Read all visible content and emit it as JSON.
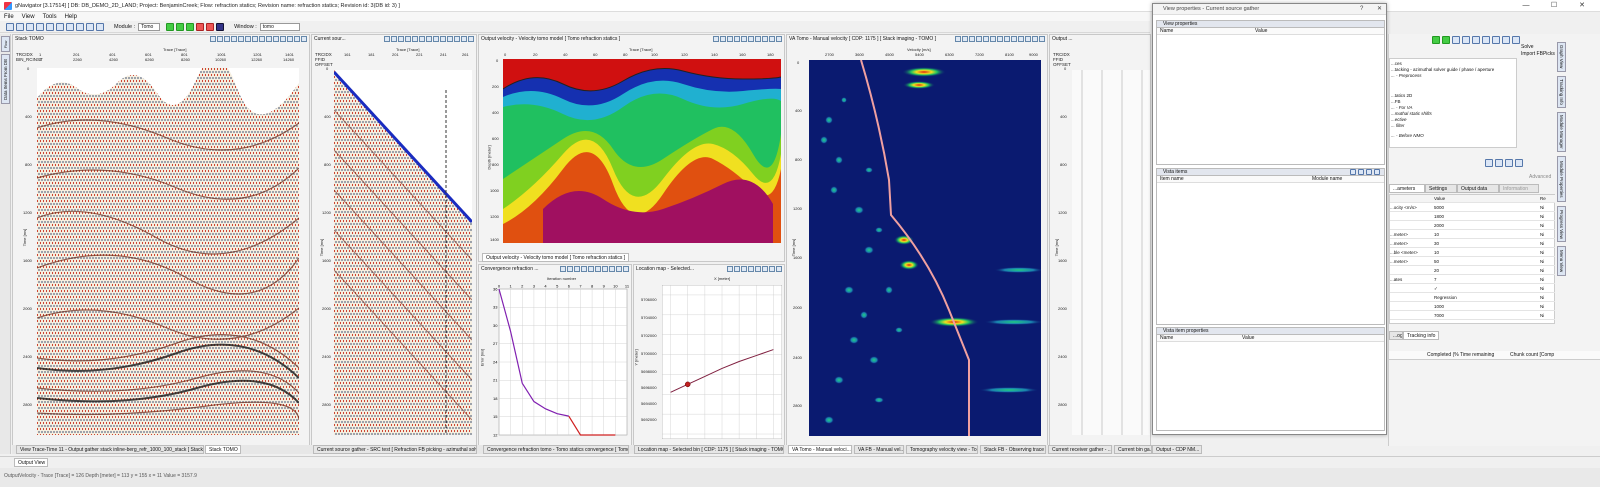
{
  "window": {
    "title": "gNavigator [3.17514] [ DB: DB_DEMO_2D_LAND; Project: BenjaminCreek; Flow: refraction statics; Revision name: refraction statics; Revision id: 3(DB id: 3) ]",
    "controls": [
      "—",
      "☐",
      "✕"
    ]
  },
  "menu": [
    "File",
    "View",
    "Tools",
    "Help"
  ],
  "toolbar": {
    "module_label": "Module :",
    "module_value": "Tomo",
    "window_label": "Window :",
    "window_value": "tomo"
  },
  "left_tabs": [
    "Data Items From DB",
    "Flow Manager"
  ],
  "panels": {
    "stack": {
      "title": "Stack TOMO",
      "headers": [
        "TRCIDX",
        "BIN_RCINST"
      ],
      "x_label": "Trace [Trace]",
      "x_ticks": [
        "1",
        "201",
        "401",
        "601",
        "801",
        "1001",
        "1201",
        "1401"
      ],
      "x_ticks2": [
        "1",
        "2260",
        "4260",
        "6260",
        "8260",
        "10260",
        "12260",
        "14260"
      ],
      "y_label": "Time [ms]",
      "y_ticks": [
        "0",
        "400",
        "800",
        "1200",
        "1600",
        "2000",
        "2400",
        "2800"
      ]
    },
    "source": {
      "title": "Current sour...",
      "headers": [
        "TRCIDX",
        "FFID",
        "OFFSET"
      ],
      "x_label": "Trace [Trace]",
      "x_ticks": [
        "161",
        "181",
        "201",
        "221",
        "241",
        "261"
      ],
      "y_label": "Time [ms]",
      "y_ticks": [
        "0",
        "400",
        "800",
        "1200",
        "1600",
        "2000",
        "2400",
        "2800"
      ]
    },
    "velocity": {
      "title": "Output velocity - Velocity tomo model [ Tomo refraction statics ]",
      "x_label": "Trace [Trace]",
      "x_ticks": [
        "0",
        "20",
        "40",
        "60",
        "80",
        "100",
        "120",
        "140",
        "160",
        "180"
      ],
      "y_label": "Depth [meter]",
      "y_ticks": [
        "0",
        "200",
        "400",
        "600",
        "800",
        "1000",
        "1200",
        "1400"
      ],
      "tab": "Output velocity - Velocity tomo model [ Tomo refraction statics ]"
    },
    "convergence": {
      "title": "Convergence refraction ...",
      "x_label": "Iteration number",
      "x_ticks": [
        "0",
        "1",
        "2",
        "3",
        "4",
        "5",
        "6",
        "7",
        "8",
        "9",
        "10",
        "11"
      ],
      "y_label": "Error [ms]",
      "y_ticks": [
        "36",
        "33",
        "30",
        "27",
        "24",
        "21",
        "18",
        "15",
        "12"
      ]
    },
    "location": {
      "title": "Location map - Selected...",
      "x_label": "X [meter]",
      "y_label": "Y [meter]",
      "y_ticks": [
        "5706000",
        "5704000",
        "5702000",
        "5700000",
        "5698000",
        "5696000",
        "5694000",
        "5692000"
      ]
    },
    "va": {
      "title": "VA Tomo - Manual velocity [ CDP: 1175 ] [ Stack imaging - TOMO ]",
      "x_label": "Velocity [m/s]",
      "x_ticks": [
        "2700",
        "3600",
        "4500",
        "5400",
        "6300",
        "7200",
        "8100",
        "9000"
      ],
      "y_label": "Time [ms]",
      "y_ticks": [
        "0",
        "400",
        "800",
        "1200",
        "1600",
        "2000",
        "2400",
        "2800"
      ]
    },
    "output": {
      "title": "Output ...",
      "headers": [
        "TRCIDX",
        "FFID",
        "OFFSET"
      ],
      "y_label": "Time [ms]",
      "y_ticks": [
        "0",
        "400",
        "800",
        "1200",
        "1600",
        "2000",
        "2400",
        "2800"
      ]
    }
  },
  "bottom_tabs": [
    "View Trace-Time 11 - Output gather stack inline-berg_refr_1000_100_stack [ Stack imaging ]",
    "Stack TOMO",
    "Current source gather - SRC test [ Refraction FB picking - azimuthal solver gu...",
    "Convergence refraction tomo - Tomo statics convergence [ Tomo refr...",
    "Location map - Selected bin [ CDP: 1175 ] [ Stack imaging - TOMO ]",
    "VA Tomo - Manual veloci...",
    "VA FB - Manual vel...",
    "Tomography velocity view - To...",
    "Stack FB - Observing trace r...",
    "Current receiver gather - ...",
    "Current bin ga...",
    "Output - CDP NM..."
  ],
  "status": {
    "tab": "Output View",
    "text": "OutputVelocity - Trace [Trace] = 126  Depth [meter] = 113 y = 155 x = 11 Value = 3157.9"
  },
  "dialog": {
    "title": "View properties - Current source gather",
    "controls": [
      "?",
      "✕"
    ],
    "view_props": {
      "header": "View properties",
      "col_name": "Name",
      "col_value": "Value"
    },
    "vista_items": {
      "header": "Vista items",
      "col_item": "Item name",
      "col_module": "Module name"
    },
    "vista_item_props": {
      "header": "Vista item properties",
      "col_name": "Name",
      "col_value": "Value"
    }
  },
  "right": {
    "top_items": [
      "Solve",
      "Import FBPicks"
    ],
    "tree": [
      "...ces",
      "...tacking - azimuthal solver guide / phase / aperture",
      "... - Preprocess",
      "...tatics 2D",
      "...FB",
      "... - For VA",
      "...muthal static shifts",
      "...ective",
      "... filter",
      "... - Before NMO"
    ],
    "advanced_label": "Advanced",
    "tabs": [
      "...ameters",
      "Settings",
      "Output data",
      "Information"
    ],
    "prop_header": [
      "Value",
      "Re"
    ],
    "props": [
      {
        "name": "...ocity <m/s>",
        "value": "5000",
        "r": "Ni"
      },
      {
        "name": "",
        "value": "1800",
        "r": "Ni"
      },
      {
        "name": "",
        "value": "2000",
        "r": "Ni"
      },
      {
        "name": "...meter>",
        "value": "10",
        "r": "Ni"
      },
      {
        "name": "...meter>",
        "value": "30",
        "r": "Ni"
      },
      {
        "name": "...ble <meter>",
        "value": "10",
        "r": "Ni"
      },
      {
        "name": "...meter>",
        "value": "50",
        "r": "Ni"
      },
      {
        "name": "",
        "value": "20",
        "r": "Ni"
      },
      {
        "name": "...ates",
        "value": "7",
        "r": "Ni"
      },
      {
        "name": "",
        "value": "✓",
        "r": "Ni"
      },
      {
        "name": "",
        "value": "Regression",
        "r": "Ni"
      },
      {
        "name": "",
        "value": "1000",
        "r": "Ni"
      },
      {
        "name": "",
        "value": "7000",
        "r": "Ni"
      }
    ],
    "bottom_tabs": [
      "...og",
      "Tracking info"
    ],
    "job_cols": [
      "Completed (% Time remaining",
      "Chunk count [Comp"
    ],
    "vtabs": [
      "Graph View",
      "Tracking Info",
      "Module Manager",
      "Module Properties",
      "Progress View",
      "Menu View"
    ]
  },
  "chart_data": [
    {
      "type": "line",
      "title": "",
      "xlabel": "Iteration number",
      "ylabel": "Error [ms]",
      "x": [
        0,
        1,
        2,
        3,
        4,
        5,
        6,
        7,
        8,
        9,
        10
      ],
      "y": [
        36,
        29,
        20.5,
        17.5,
        16.3,
        15.5,
        15.1,
        12,
        12,
        12,
        12
      ],
      "xlim": [
        0,
        11
      ],
      "ylim": [
        12,
        36
      ]
    },
    {
      "type": "line",
      "title": "",
      "xlabel": "X [meter]",
      "ylabel": "Y [meter]",
      "x": [
        630000,
        632000,
        634000,
        636000,
        638000,
        640000,
        642000
      ],
      "y": [
        5696200,
        5697000,
        5697800,
        5698600,
        5699300,
        5699900,
        5700500
      ]
    }
  ],
  "colors": {
    "accent": "#3366cc",
    "vel_red": "#d01010",
    "va_bg": "#0a1a70"
  }
}
